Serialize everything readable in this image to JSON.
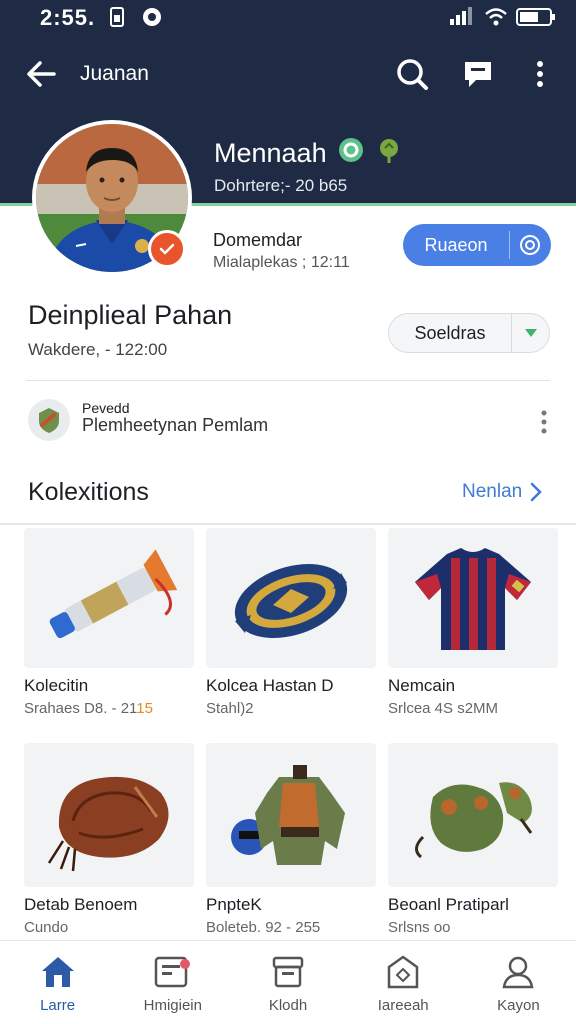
{
  "status_bar": {
    "time": "2:55."
  },
  "appbar": {
    "title": "Juanan"
  },
  "profile": {
    "name": "Mennaah",
    "subheading": "Dohrtere;- 20 b65",
    "owner": "Domemdar",
    "owner_sub": "Mialaplekas ; 12:11",
    "follow_label": "Ruaeon"
  },
  "section": {
    "title": "Deinplieal Pahan",
    "sub": "Wakdere, - 122:00",
    "sort_label": "Soeldras"
  },
  "notification": {
    "label": "Pevedd",
    "text": "Plemheetynan Pemlam"
  },
  "collections": {
    "title": "Kolexitions",
    "link": "Nenlan",
    "items": [
      {
        "title": "Kolecitin",
        "sub": "Srahaes D8. - 21",
        "sub_highlight": "15"
      },
      {
        "title": "Kolcea Hastan D",
        "sub": "Stahl)2",
        "sub_highlight": ""
      },
      {
        "title": "Nemcain",
        "sub": "Srlcea 4S s2MM",
        "sub_highlight": ""
      },
      {
        "title": "Detab Benoem",
        "sub": "Cundo",
        "sub_highlight": ""
      },
      {
        "title": "PnpteK",
        "sub": "Boleteb. 92 - 255",
        "sub_highlight": ""
      },
      {
        "title": "Beoanl Pratiparl",
        "sub": "Srlsns oo",
        "sub_highlight": ""
      }
    ]
  },
  "bottom_nav": [
    {
      "label": "Larre",
      "icon": "home-icon"
    },
    {
      "label": "Hmigiein",
      "icon": "calendar-card-icon"
    },
    {
      "label": "Klodh",
      "icon": "archive-icon"
    },
    {
      "label": "Iareeah",
      "icon": "map-icon"
    },
    {
      "label": "Kayon",
      "icon": "person-icon"
    }
  ],
  "colors": {
    "header": "#1f2a45",
    "accent_green": "#7ed29a",
    "primary_blue": "#4a7fe6",
    "badge_orange": "#e8542b",
    "link_blue": "#3e7ad6"
  }
}
